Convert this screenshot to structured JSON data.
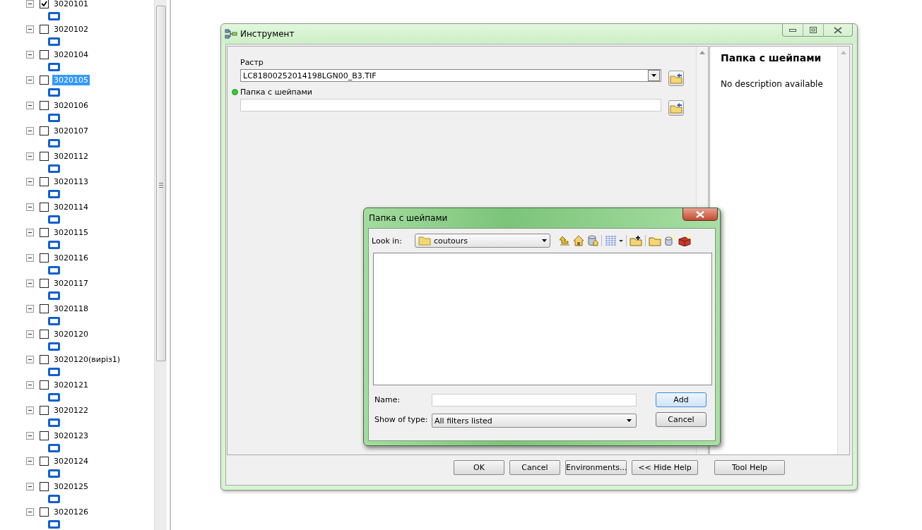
{
  "tree": {
    "items": [
      {
        "label": "3020101",
        "checked": true,
        "selected": false,
        "expanded": true
      },
      {
        "label": "3020102",
        "checked": false,
        "selected": false,
        "expanded": true
      },
      {
        "label": "3020104",
        "checked": false,
        "selected": false,
        "expanded": true
      },
      {
        "label": "3020105",
        "checked": false,
        "selected": true,
        "expanded": true
      },
      {
        "label": "3020106",
        "checked": false,
        "selected": false,
        "expanded": true
      },
      {
        "label": "3020107",
        "checked": false,
        "selected": false,
        "expanded": true
      },
      {
        "label": "3020112",
        "checked": false,
        "selected": false,
        "expanded": true
      },
      {
        "label": "3020113",
        "checked": false,
        "selected": false,
        "expanded": true
      },
      {
        "label": "3020114",
        "checked": false,
        "selected": false,
        "expanded": true
      },
      {
        "label": "3020115",
        "checked": false,
        "selected": false,
        "expanded": true
      },
      {
        "label": "3020116",
        "checked": false,
        "selected": false,
        "expanded": true
      },
      {
        "label": "3020117",
        "checked": false,
        "selected": false,
        "expanded": true
      },
      {
        "label": "3020118",
        "checked": false,
        "selected": false,
        "expanded": true
      },
      {
        "label": "3020120",
        "checked": false,
        "selected": false,
        "expanded": true
      },
      {
        "label": "3020120(виріз1)",
        "checked": false,
        "selected": false,
        "expanded": true
      },
      {
        "label": "3020121",
        "checked": false,
        "selected": false,
        "expanded": true
      },
      {
        "label": "3020122",
        "checked": false,
        "selected": false,
        "expanded": true
      },
      {
        "label": "3020123",
        "checked": false,
        "selected": false,
        "expanded": true
      },
      {
        "label": "3020124",
        "checked": false,
        "selected": false,
        "expanded": true
      },
      {
        "label": "3020125",
        "checked": false,
        "selected": false,
        "expanded": true
      },
      {
        "label": "3020126",
        "checked": false,
        "selected": false,
        "expanded": true
      }
    ]
  },
  "tool": {
    "title": "Инструмент",
    "parameters": [
      {
        "label": "Растр",
        "kind": "dropdown",
        "value": "LC81800252014198LGN00_B3.TIF",
        "required": false
      },
      {
        "label": "Папка с шейпами",
        "kind": "text",
        "required": true
      }
    ],
    "help": {
      "title": "Папка с шейпами",
      "text": "No description available"
    },
    "buttons": [
      "OK",
      "Cancel",
      "Environments...",
      "<< Hide Help",
      "Tool Help"
    ]
  },
  "dialog": {
    "title": "Папка с шейпами",
    "look_in_label": "Look in:",
    "look_in": "coutours",
    "name_label": "Name:",
    "type_label": "Show of type:",
    "type": "All filters listed",
    "buttons": [
      {
        "label": "Add",
        "default": true
      },
      {
        "label": "Cancel",
        "default": false
      }
    ]
  }
}
